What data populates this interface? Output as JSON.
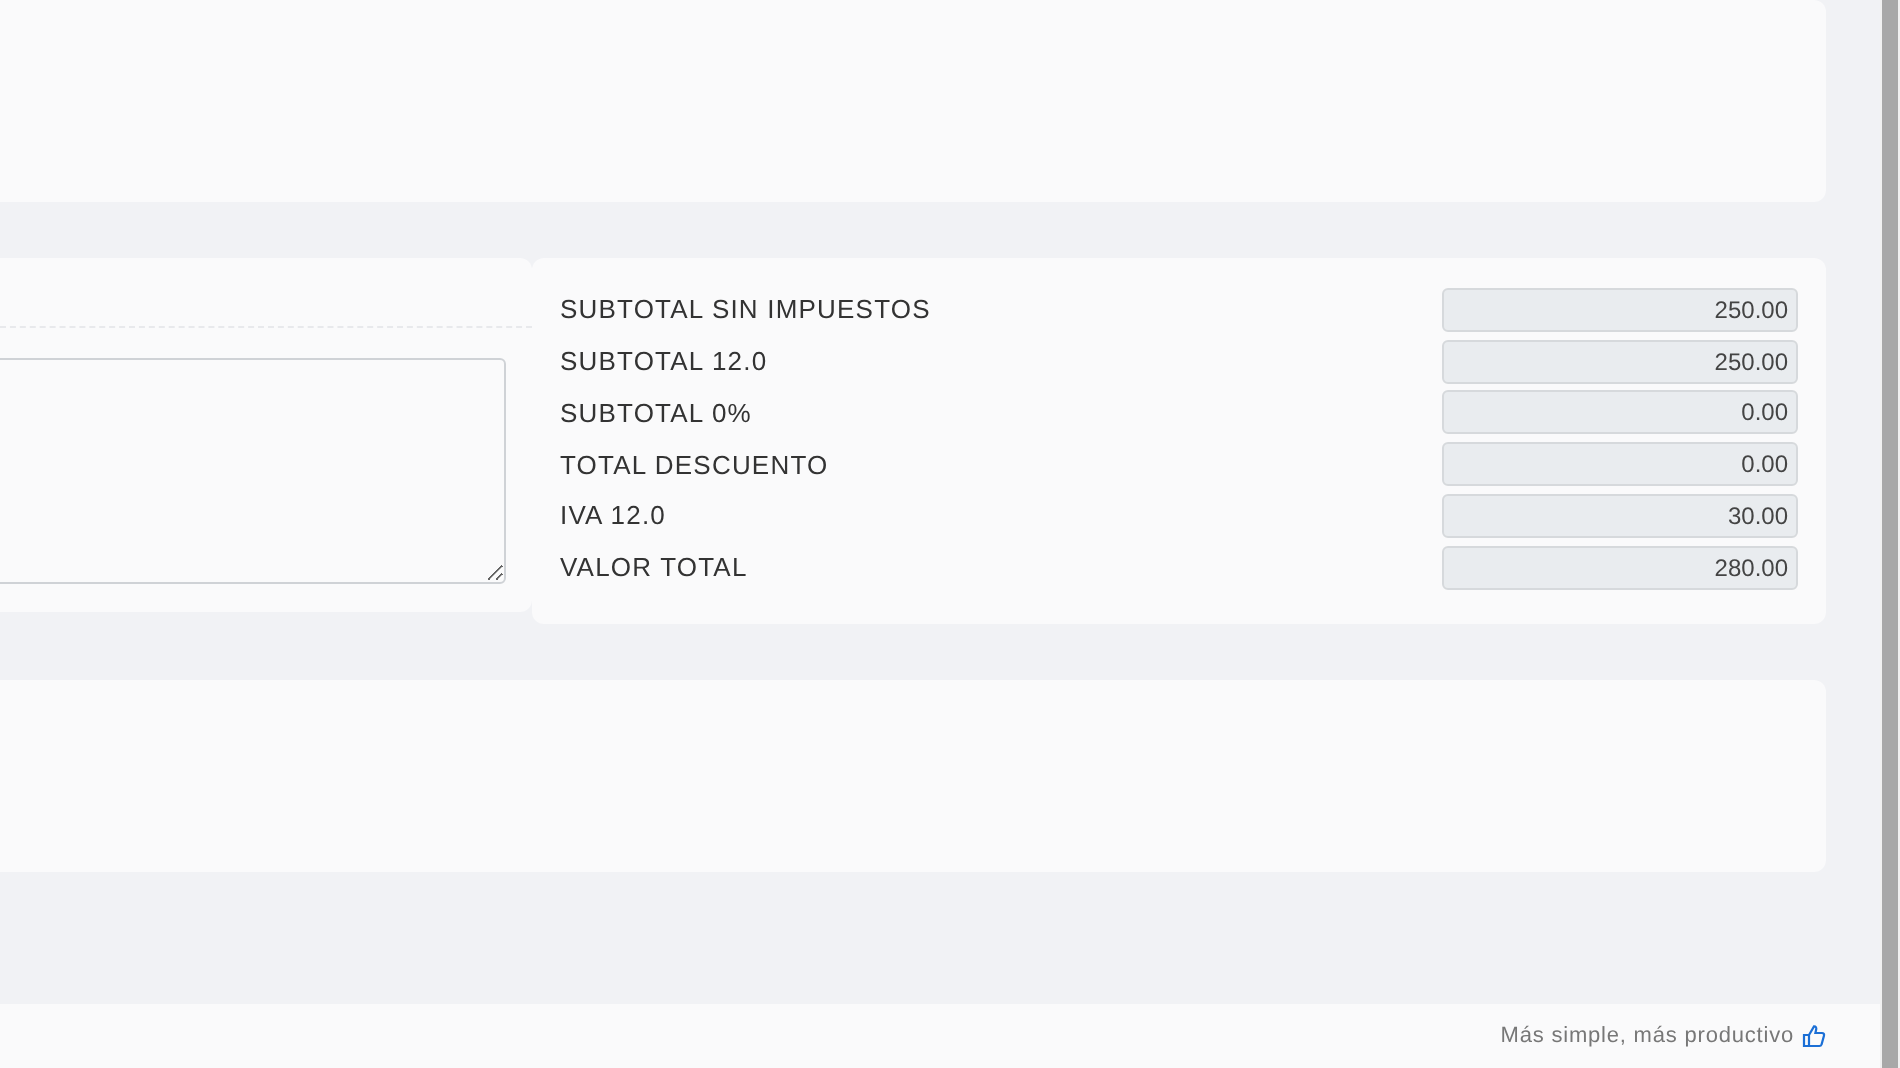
{
  "notes_panel": {
    "textarea": {
      "kind": "textarea"
    }
  },
  "totals": [
    {
      "label": "SUBTOTAL SIN IMPUESTOS",
      "value": "250.00"
    },
    {
      "label": "SUBTOTAL 12.0",
      "value": "250.00"
    },
    {
      "label": "SUBTOTAL 0%",
      "value": "0.00"
    },
    {
      "label": "TOTAL DESCUENTO",
      "value": "0.00"
    },
    {
      "label": "IVA 12.0",
      "value": "30.00"
    },
    {
      "label": "VALOR TOTAL",
      "value": "280.00"
    }
  ],
  "footer": {
    "tagline": "Más simple, más productivo"
  }
}
